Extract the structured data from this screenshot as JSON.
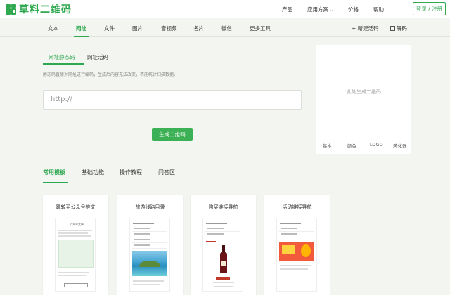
{
  "header": {
    "logo_text": "草料二维码",
    "nav": [
      "产品",
      "应用方案",
      "价格",
      "帮助"
    ],
    "dropdown_arrow": "⌄",
    "login_label": "登录 / 注册"
  },
  "navbar": {
    "items": [
      "文本",
      "网址",
      "文件",
      "图片",
      "音视频",
      "名片",
      "微信",
      "更多工具"
    ],
    "active": "网址",
    "new_code": "+ 新建活码",
    "decode": "解码"
  },
  "subtabs": [
    "网址静态码",
    "网址活码"
  ],
  "description": "静态码直接对网址进行编码，生成后内容无法改变，不能统计扫描数据。",
  "url_input": {
    "placeholder": "http://"
  },
  "generate_label": "生成二维码",
  "qr_panel": {
    "placeholder": "此处生成二维码",
    "tools": [
      "基本",
      "颜色",
      "LOGO",
      "美化器"
    ]
  },
  "section_tabs": [
    "常用模板",
    "基础功能",
    "操作教程",
    "问答区"
  ],
  "cards": [
    {
      "title": "跳转至公众号推文",
      "phone_header": "公众号文章"
    },
    {
      "title": "旅游线路目录",
      "phone_header": ""
    },
    {
      "title": "购买链接导航",
      "phone_header": ""
    },
    {
      "title": "活动链接导航",
      "phone_header": ""
    }
  ],
  "colors": {
    "accent": "#2fa84f",
    "background": "#f3f5f1",
    "button": "#3cb054"
  }
}
